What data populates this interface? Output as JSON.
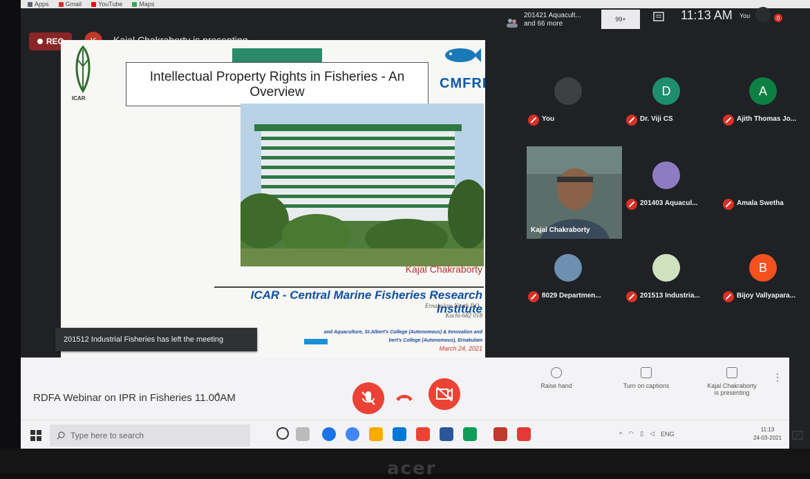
{
  "browser": {
    "bookmarks": [
      {
        "label": "Apps",
        "color": "#5f6368"
      },
      {
        "label": "Gmail",
        "color": "#d93025"
      },
      {
        "label": "YouTube",
        "color": "#ff0000"
      },
      {
        "label": "Maps",
        "color": "#34a853"
      }
    ]
  },
  "meet": {
    "rec_label": "REC",
    "presenter_initial": "K",
    "presenter_status": "Kajal Chakraborty is presenting",
    "people_line1": "201421 Aquacult...",
    "people_line2": "and 66 more",
    "chat_label": "99+",
    "time": "11:13 AM",
    "you_label": "You",
    "notification_count": "0"
  },
  "slide": {
    "title": "Intellectual Property Rights in Fisheries - An Overview",
    "tag_text": "",
    "icar_label": "ICAR",
    "cmfri_sub": "",
    "cmfri_name": "CMFRI",
    "speaker": "Kajal Chakraborty",
    "institute": "ICAR - Central Marine Fisheries Research Institute",
    "address_line1": "Ernakulam North P.O.,",
    "address_line2": "Kochi-682 018",
    "footer_line1": "and Aquaculture, St.Albert's College (Autonomous) & Innovation and",
    "footer_line2": "bert's College (Autonomous), Ernakulam",
    "date": "March 24, 2021"
  },
  "toast": {
    "message": "201512 Industrial Fisheries has left the meeting"
  },
  "participants": [
    {
      "name": "You",
      "initial": "",
      "color": "#3c4043"
    },
    {
      "name": "Dr. Viji CS",
      "initial": "D",
      "color": "#1e8e6e"
    },
    {
      "name": "Ajith Thomas Jo...",
      "initial": "A",
      "color": "#0b8043"
    },
    {
      "name": "201403 Aquacul...",
      "initial": "",
      "color": "#8e7cc3"
    },
    {
      "name": "Amala Swetha",
      "initial": "",
      "color": "#202124"
    },
    {
      "name": "8029 Departmen...",
      "initial": "",
      "color": "#6d8fb0"
    },
    {
      "name": "201513 Industria...",
      "initial": "",
      "color": "#cfe2c0"
    },
    {
      "name": "Bijoy Vallyapara...",
      "initial": "B",
      "color": "#f4511e"
    }
  ],
  "video_name": "Kajal Chakraborty",
  "bottom_bar": {
    "meeting_title": "RDFA Webinar on IPR in Fisheries 11.00AM",
    "caret": "^",
    "raise_hand": "Raise hand",
    "captions": "Turn on captions",
    "presenting_line1": "Kajal Chakraborty",
    "presenting_line2": "is presenting",
    "more": "⋮"
  },
  "taskbar": {
    "search_placeholder": "Type here to search",
    "tray_lang": "ENG",
    "clock_time": "11:13",
    "clock_date": "24-03-2021",
    "apps": [
      "#1a73e8",
      "#4285f4",
      "#f9ab00",
      "#0078d4",
      "#ea4335",
      "#0f9d58",
      "#2b579a",
      "#c0392b",
      "#e53935"
    ]
  }
}
